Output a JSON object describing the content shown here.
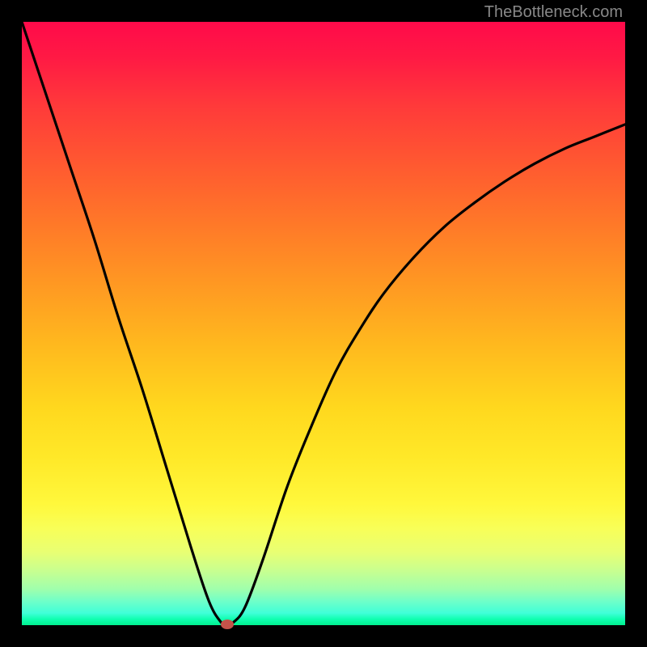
{
  "watermark": "TheBottleneck.com",
  "chart_data": {
    "type": "line",
    "title": "",
    "xlabel": "",
    "ylabel": "",
    "x_range": [
      0,
      100
    ],
    "y_range": [
      0,
      100
    ],
    "series": [
      {
        "name": "bottleneck-curve",
        "x": [
          0,
          4,
          8,
          12,
          16,
          20,
          24,
          28,
          31,
          33,
          34,
          35,
          37,
          40,
          44,
          48,
          52,
          56,
          60,
          65,
          70,
          75,
          80,
          85,
          90,
          95,
          100
        ],
        "y": [
          100,
          88,
          76,
          64,
          51,
          39,
          26,
          13,
          4,
          0.5,
          0,
          0.4,
          3,
          11,
          23,
          33,
          42,
          49,
          55,
          61,
          66,
          70,
          73.5,
          76.5,
          79,
          81,
          83
        ]
      }
    ],
    "marker": {
      "x": 34,
      "y": 0,
      "color": "#c5534a"
    },
    "gradient_description": "vertical rainbow red-to-green"
  }
}
